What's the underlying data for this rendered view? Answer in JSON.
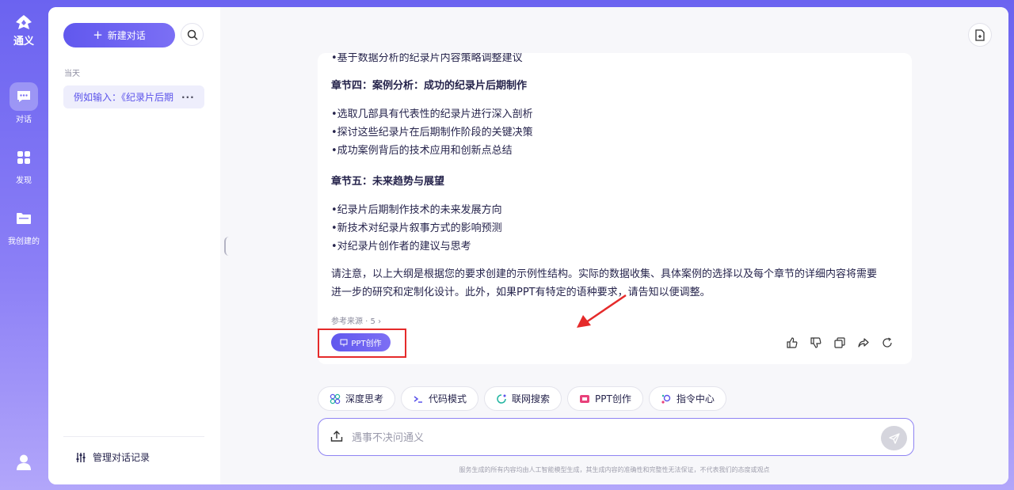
{
  "app": {
    "name": "通义"
  },
  "rail": {
    "items": [
      {
        "label": "对话",
        "icon": "chat-bubble-icon"
      },
      {
        "label": "发现",
        "icon": "grid-icon"
      },
      {
        "label": "我创建的",
        "icon": "folder-icon"
      }
    ],
    "user_icon": "user-icon"
  },
  "sidebar": {
    "new_chat_label": "新建对话",
    "section_today": "当天",
    "history": [
      {
        "title": "例如输入：《纪录片后期"
      }
    ],
    "manage_label": "管理对话记录"
  },
  "answer": {
    "cut_line": "•基于数据分析的纪录片内容策略调整建议",
    "sections": [
      {
        "title": "章节四：案例分析：成功的纪录片后期制作",
        "bullets": [
          "•选取几部具有代表性的纪录片进行深入剖析",
          "•探讨这些纪录片在后期制作阶段的关键决策",
          "•成功案例背后的技术应用和创新点总结"
        ]
      },
      {
        "title": "章节五：未来趋势与展望",
        "bullets": [
          "•纪录片后期制作技术的未来发展方向",
          "•新技术对纪录片叙事方式的影响预测",
          "•对纪录片创作者的建议与思考"
        ]
      }
    ],
    "note_line1": "请注意，以上大纲是根据您的要求创建的示例性结构。实际的数据收集、具体案例的选择以及每个章节的详细内容将需要",
    "note_line2": "进一步的研究和定制化设计。此外，如果PPT有特定的语种要求，请告知以便调整。",
    "refs": "参考来源 · 5",
    "ppt_button": "PPT创作"
  },
  "tools": [
    {
      "label": "深度思考",
      "icon": "deep-think-icon",
      "color": "#5b53ea"
    },
    {
      "label": "代码模式",
      "icon": "code-icon",
      "color": "#5b53ea"
    },
    {
      "label": "联网搜索",
      "icon": "web-search-icon",
      "color": "#22b5a0"
    },
    {
      "label": "PPT创作",
      "icon": "ppt-icon",
      "color": "#e8417a"
    },
    {
      "label": "指令中心",
      "icon": "command-icon",
      "color": "#5b53ea"
    }
  ],
  "input": {
    "placeholder": "遇事不决问通义"
  },
  "disclaimer": "服务生成的所有内容均由人工智能模型生成，其生成内容的准确性和完整性无法保证，不代表我们的态度或观点",
  "colors": {
    "accent": "#5b53ea",
    "highlight": "#e52a2a"
  }
}
